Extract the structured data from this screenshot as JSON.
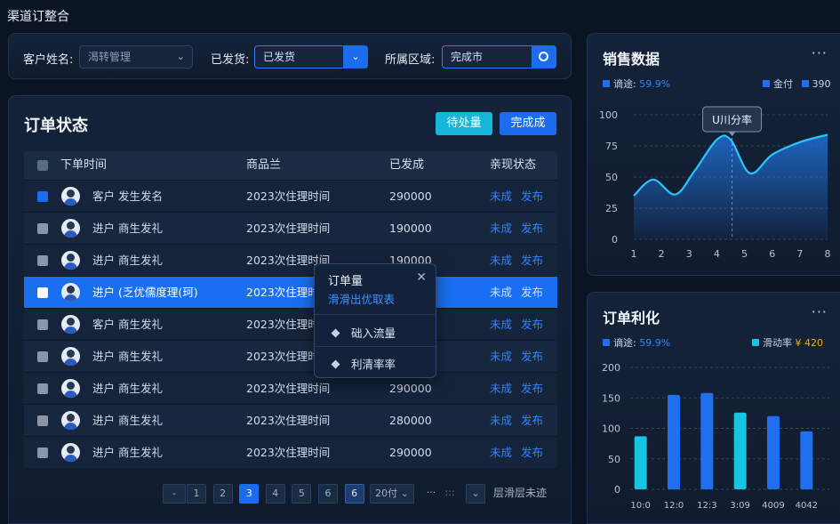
{
  "app": {
    "title": "渠道订整合"
  },
  "filters": {
    "customer_label": "客户姓名:",
    "customer_value": "渴转管理",
    "shipped_label": "已发货:",
    "shipped_value": "已发货",
    "region_label": "所属区域:",
    "region_value": "完成市"
  },
  "orders": {
    "title": "订单状态",
    "btn_pending": "待处量",
    "btn_complete": "完成成",
    "columns": [
      "下单时间",
      "商品兰",
      "已发成",
      "亲现状态"
    ],
    "rows": [
      {
        "name": "客户  发生发名",
        "product": "2023次住理时间",
        "amount": "290000",
        "a1": "未成",
        "a2": "发布",
        "checked": true,
        "selected": false
      },
      {
        "name": "进户  商生发礼",
        "product": "2023次住理时间",
        "amount": "190000",
        "a1": "未成",
        "a2": "发布",
        "checked": false,
        "selected": false
      },
      {
        "name": "进户  商生发礼",
        "product": "2023次住理时间",
        "amount": "190000",
        "a1": "未成",
        "a2": "发布",
        "checked": false,
        "selected": false
      },
      {
        "name": "进户 (乏优儒度理(珂)",
        "product": "2023次住理时",
        "amount": "",
        "a1": "未成",
        "a2": "发布",
        "checked": false,
        "selected": true
      },
      {
        "name": "客户  商生发礼",
        "product": "2023次住理时间",
        "amount": "",
        "a1": "未成",
        "a2": "发布",
        "checked": false,
        "selected": false
      },
      {
        "name": "进户  商生发礼",
        "product": "2023次住理时间",
        "amount": "",
        "a1": "未成",
        "a2": "发布",
        "checked": false,
        "selected": false
      },
      {
        "name": "进户  商生发礼",
        "product": "2023次住理时间",
        "amount": "290000",
        "a1": "未成",
        "a2": "发布",
        "checked": false,
        "selected": false
      },
      {
        "name": "进户  商生发礼",
        "product": "2023次住理时间",
        "amount": "280000",
        "a1": "未成",
        "a2": "发布",
        "checked": false,
        "selected": false
      },
      {
        "name": "进户  商生发礼",
        "product": "2023次住理时间",
        "amount": "290000",
        "a1": "未成",
        "a2": "发布",
        "checked": false,
        "selected": false
      }
    ]
  },
  "popup": {
    "title": "订单量",
    "subtitle": "滑滑出优取表",
    "items": [
      "础入流量",
      "利清率率"
    ]
  },
  "pagination": {
    "prev": "-",
    "pages": [
      "1",
      "2",
      "3",
      "4",
      "5",
      "6",
      "6"
    ],
    "current_index": 2,
    "size": "20付",
    "dots": "···",
    "colon": ":::",
    "jump": "层滑层未迹"
  },
  "sales": {
    "title": "销售数据",
    "more": "···",
    "legend_left_label": "谪途:",
    "legend_left_value": "59.9%",
    "legend_right": [
      "金付",
      "390"
    ],
    "tooltip": "U川分率",
    "colors": {
      "line": "#2bc4ff",
      "fill": "#1f6fd6"
    }
  },
  "profit": {
    "title": "订单利化",
    "more": "···",
    "legend_left_label": "谪途:",
    "legend_left_value": "59.9%",
    "legend_right_label": "滑动率",
    "legend_right_value": "¥ 420",
    "colors": {
      "cyan": "#17c5e3",
      "blue": "#1f6ff0"
    }
  },
  "chart_data": [
    {
      "type": "area",
      "x": [
        1,
        2,
        3,
        4,
        5,
        6,
        7,
        8
      ],
      "ylim": [
        0,
        100
      ],
      "yticks": [
        0,
        25,
        50,
        75,
        100
      ],
      "points": [
        [
          1,
          35
        ],
        [
          1.7,
          48
        ],
        [
          2.5,
          36
        ],
        [
          3.2,
          55
        ],
        [
          4,
          80
        ],
        [
          4.5,
          80
        ],
        [
          5.2,
          53
        ],
        [
          6,
          68
        ],
        [
          7,
          78
        ],
        [
          8,
          84
        ]
      ],
      "grid": true
    },
    {
      "type": "bar",
      "categories": [
        "10:0",
        "12:0",
        "12:3",
        "3:09",
        "4009",
        "4042"
      ],
      "values": [
        87,
        155,
        158,
        126,
        120,
        95
      ],
      "colors": [
        "cyan",
        "blue",
        "blue",
        "cyan",
        "blue",
        "blue"
      ],
      "ylim": [
        0,
        200
      ],
      "yticks": [
        0,
        50,
        100,
        150,
        200
      ],
      "grid": true
    }
  ]
}
